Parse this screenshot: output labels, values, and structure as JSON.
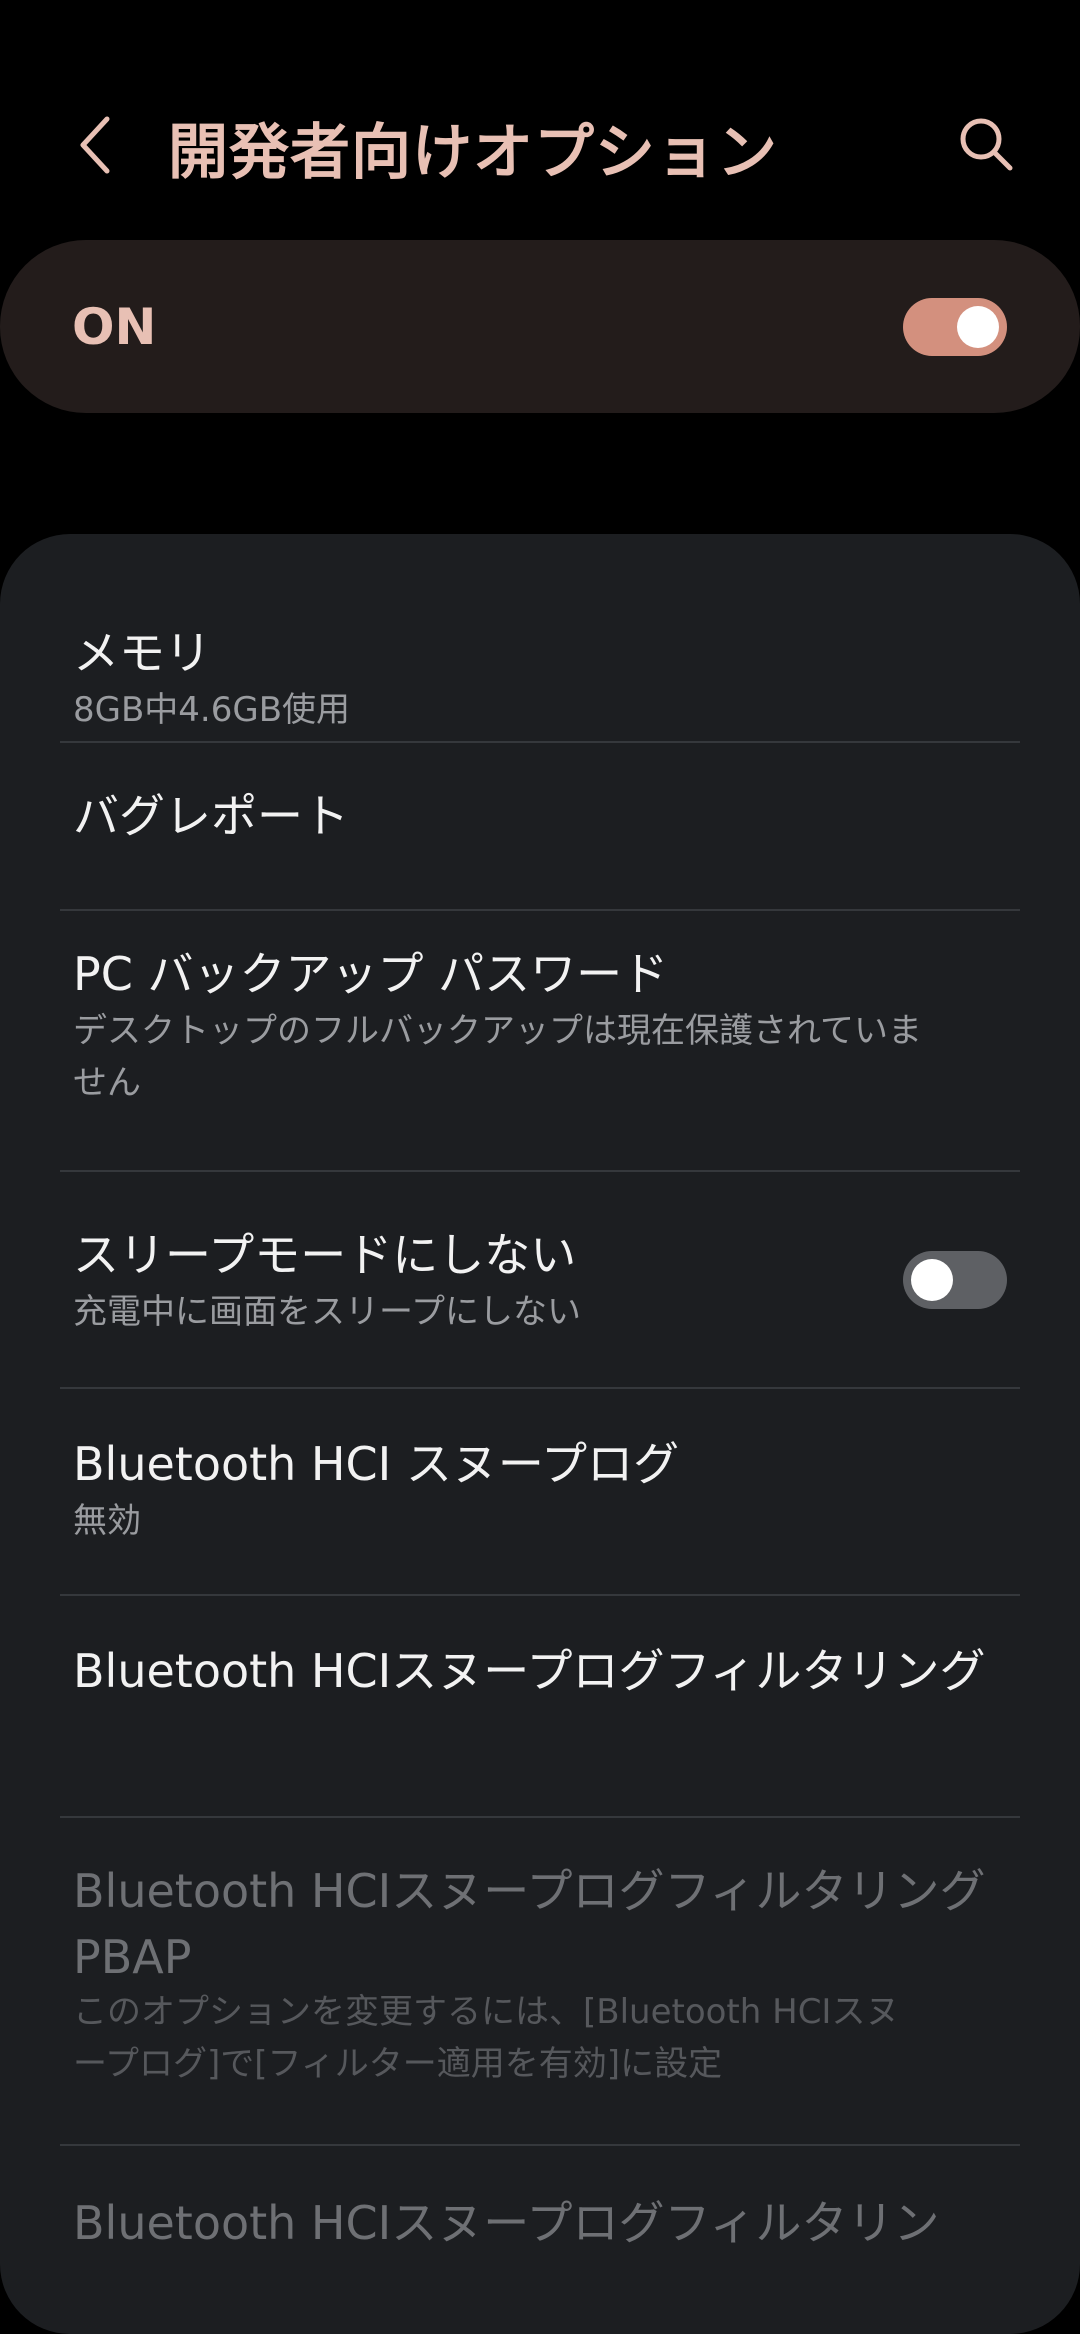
{
  "header": {
    "title": "開発者向けオプション",
    "back_icon": "chevron-left-icon",
    "search_icon": "search-icon"
  },
  "master_switch": {
    "label": "ON",
    "state": true
  },
  "items": [
    {
      "title": "メモリ",
      "summary": "8GB中4.6GB使用"
    },
    {
      "title": "バグレポート"
    },
    {
      "title": "PC バックアップ パスワード",
      "summary": "デスクトップのフルバックアップは現在保護されていません"
    },
    {
      "title": "スリープモードにしない",
      "summary": "充電中に画面をスリープにしない",
      "toggle": false
    },
    {
      "title": "Bluetooth HCI スヌープログ",
      "summary": "無効"
    },
    {
      "title": "Bluetooth HCIスヌープログフィルタリング"
    },
    {
      "title": "Bluetooth HCIスヌープログフィルタリングPBAP",
      "summary": "このオプションを変更するには、[Bluetooth HCIスヌープログ]で[フィルター適用を有効]に設定",
      "disabled": true
    },
    {
      "title": "Bluetooth HCIスヌープログフィルタリン",
      "disabled": true
    }
  ],
  "colors": {
    "accent": "#e8c0b4",
    "toggle_on": "#d3907e",
    "toggle_off": "#5e6064",
    "card_bg": "#1c1e21",
    "master_bg": "#231c1b"
  }
}
